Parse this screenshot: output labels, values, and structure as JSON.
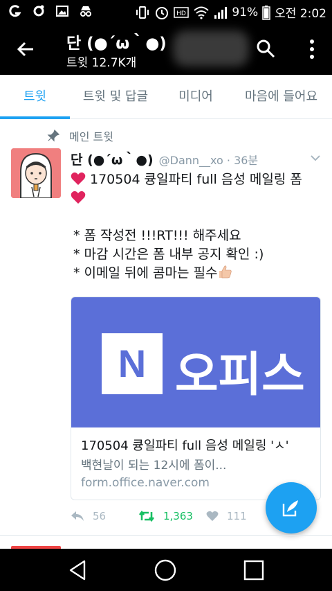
{
  "status_bar": {
    "battery": "91%",
    "time": "오전 2:02",
    "icons": [
      "g-icon",
      "settings-gear-icon",
      "image-icon",
      "incognito-icon",
      "vibrate-icon",
      "alarm-icon",
      "hd-icon",
      "wifi-icon",
      "signal-icon",
      "battery-icon"
    ]
  },
  "header": {
    "title": "단 (●´ω｀●)",
    "subtitle": "트윗 12.7K개"
  },
  "tabs": [
    {
      "label": "트윗",
      "active": true
    },
    {
      "label": "트윗 및 답글",
      "active": false
    },
    {
      "label": "미디어",
      "active": false
    },
    {
      "label": "마음에 들어요",
      "active": false
    }
  ],
  "tweet": {
    "pinned_label": "메인 트윗",
    "name": "단 (●´ω｀●)",
    "handle_time": "@Dann__xo · 36분",
    "line1": "170504 큥일파티 full 음성 메일링 폼",
    "line2": "* 폼 작성전 !!!RT!!! 해주세요",
    "line3": "* 마감 시간은 폼 내부 공지 확인 :)",
    "line4": "* 이메일 뒤에 콤마는 필수",
    "card": {
      "logo_letter": "N",
      "logo_word": "오피스",
      "title": "170504 큥일파티 full 음성 메일링 'ㅅ'",
      "description": "백현날이 되는 12시에 폼이...",
      "url": "form.office.naver.com"
    },
    "actions": {
      "replies": "56",
      "retweets": "1,363",
      "likes": "111"
    }
  },
  "colors": {
    "accent": "#1da1f2",
    "retweet_green": "#17bf63",
    "heart_red": "#e0245e",
    "card_blue": "#5b6fd8"
  }
}
